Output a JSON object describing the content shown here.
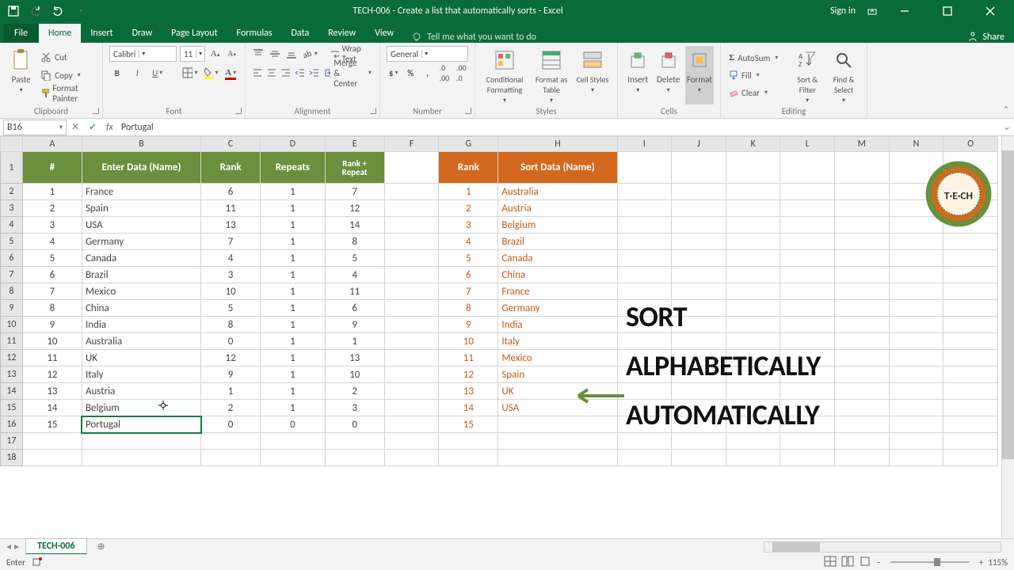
{
  "title": "TECH-006 - Create a list that automatically sorts - Excel",
  "signin": "Sign in",
  "menu": {
    "file": "File",
    "home": "Home",
    "insert": "Insert",
    "draw": "Draw",
    "layout": "Page Layout",
    "formulas": "Formulas",
    "data": "Data",
    "review": "Review",
    "view": "View",
    "tell": "Tell me what you want to do",
    "share": "Share"
  },
  "ribbon": {
    "clipboard": "Clipboard",
    "paste": "Paste",
    "cut": "Cut",
    "copy": "Copy",
    "painter": "Format Painter",
    "font_group": "Font",
    "font": "Calibri",
    "fontsize": "11",
    "alignment": "Alignment",
    "wrap": "Wrap Text",
    "merge": "Merge & Center",
    "number": "Number",
    "numfmt": "General",
    "styles": "Styles",
    "cond": "Conditional Formatting",
    "fat": "Format as Table",
    "cellstyles": "Cell Styles",
    "cells": "Cells",
    "insert": "Insert",
    "delete": "Delete",
    "format": "Format",
    "editing": "Editing",
    "autosum": "AutoSum",
    "fill": "Fill",
    "clear": "Clear",
    "sort": "Sort & Filter",
    "find": "Find & Select"
  },
  "namebox": "B16",
  "formula": "Portugal",
  "cols": [
    "A",
    "B",
    "C",
    "D",
    "E",
    "F",
    "G",
    "H",
    "I",
    "J",
    "K",
    "L",
    "M",
    "N",
    "O"
  ],
  "left_headers": [
    "#",
    "Enter Data (Name)",
    "Rank",
    "Repeats",
    "Rank + Repeat"
  ],
  "right_headers": [
    "Rank",
    "Sort Data (Name)"
  ],
  "left_rows": [
    {
      "n": 1,
      "name": "France",
      "rank": 6,
      "rep": 1,
      "rr": 7
    },
    {
      "n": 2,
      "name": "Spain",
      "rank": 11,
      "rep": 1,
      "rr": 12
    },
    {
      "n": 3,
      "name": "USA",
      "rank": 13,
      "rep": 1,
      "rr": 14
    },
    {
      "n": 4,
      "name": "Germany",
      "rank": 7,
      "rep": 1,
      "rr": 8
    },
    {
      "n": 5,
      "name": "Canada",
      "rank": 4,
      "rep": 1,
      "rr": 5
    },
    {
      "n": 6,
      "name": "Brazil",
      "rank": 3,
      "rep": 1,
      "rr": 4
    },
    {
      "n": 7,
      "name": "Mexico",
      "rank": 10,
      "rep": 1,
      "rr": 11
    },
    {
      "n": 8,
      "name": "China",
      "rank": 5,
      "rep": 1,
      "rr": 6
    },
    {
      "n": 9,
      "name": "India",
      "rank": 8,
      "rep": 1,
      "rr": 9
    },
    {
      "n": 10,
      "name": "Australia",
      "rank": 0,
      "rep": 1,
      "rr": 1
    },
    {
      "n": 11,
      "name": "UK",
      "rank": 12,
      "rep": 1,
      "rr": 13
    },
    {
      "n": 12,
      "name": "Italy",
      "rank": 9,
      "rep": 1,
      "rr": 10
    },
    {
      "n": 13,
      "name": "Austria",
      "rank": 1,
      "rep": 1,
      "rr": 2
    },
    {
      "n": 14,
      "name": "Belgium",
      "rank": 2,
      "rep": 1,
      "rr": 3
    },
    {
      "n": 15,
      "name": "Portugal",
      "rank": 0,
      "rep": 0,
      "rr": 0
    }
  ],
  "right_rows": [
    {
      "r": 1,
      "name": "Australia"
    },
    {
      "r": 2,
      "name": "Austria"
    },
    {
      "r": 3,
      "name": "Belgium"
    },
    {
      "r": 4,
      "name": "Brazil"
    },
    {
      "r": 5,
      "name": "Canada"
    },
    {
      "r": 6,
      "name": "China"
    },
    {
      "r": 7,
      "name": "France"
    },
    {
      "r": 8,
      "name": "Germany"
    },
    {
      "r": 9,
      "name": "India"
    },
    {
      "r": 10,
      "name": "Italy"
    },
    {
      "r": 11,
      "name": "Mexico"
    },
    {
      "r": 12,
      "name": "Spain"
    },
    {
      "r": 13,
      "name": "UK"
    },
    {
      "r": 14,
      "name": "USA"
    },
    {
      "r": 15,
      "name": ""
    }
  ],
  "overlay": {
    "l1": "SORT",
    "l2": "ALPHABETICALLY",
    "l3": "AUTOMATICALLY"
  },
  "sheet_tab": "TECH-006",
  "status": "Enter",
  "zoom": "115%"
}
